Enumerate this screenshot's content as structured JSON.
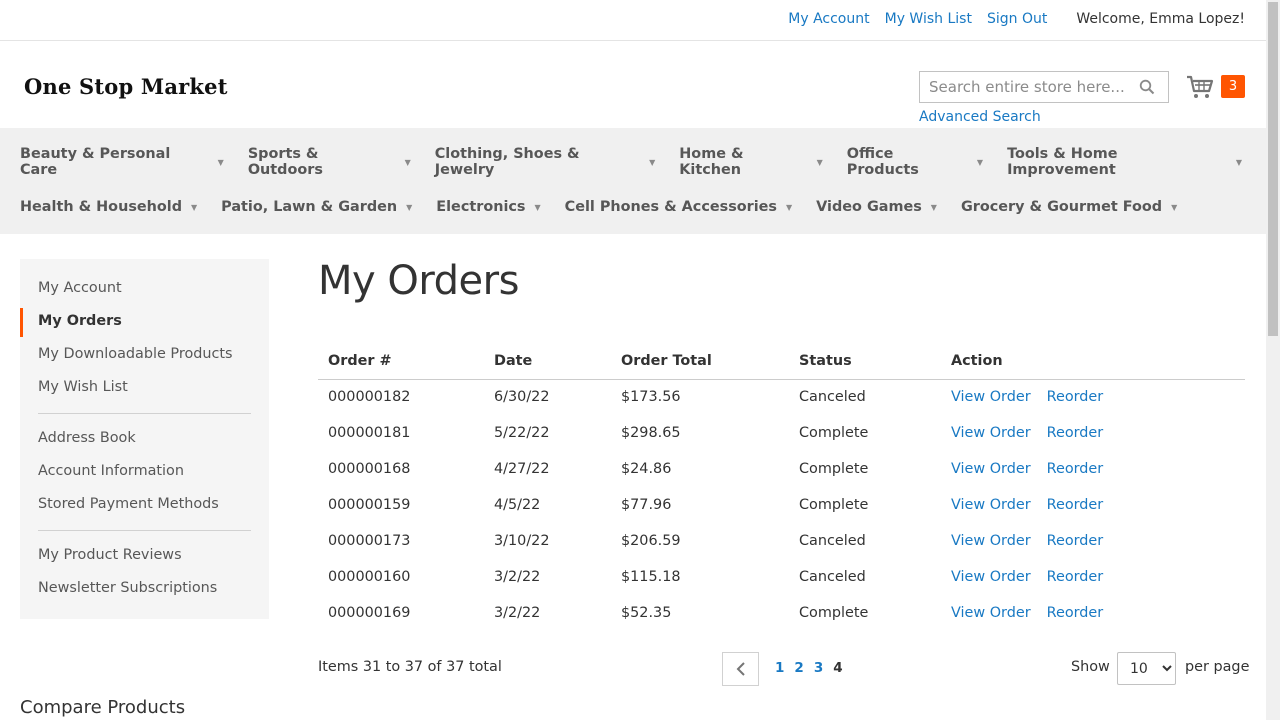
{
  "header": {
    "links": [
      "My Account",
      "My Wish List",
      "Sign Out"
    ],
    "welcome": "Welcome, Emma Lopez!"
  },
  "logo": {
    "text": "One Stop Market"
  },
  "search": {
    "placeholder": "Search entire store here...",
    "icon": "search-icon",
    "advanced_label": "Advanced Search"
  },
  "cart": {
    "icon": "cart-icon",
    "count": "3"
  },
  "nav": {
    "row1": [
      "Beauty & Personal Care",
      "Sports & Outdoors",
      "Clothing, Shoes & Jewelry",
      "Home & Kitchen",
      "Office Products",
      "Tools & Home Improvement"
    ],
    "row2": [
      "Health & Household",
      "Patio, Lawn & Garden",
      "Electronics",
      "Cell Phones & Accessories",
      "Video Games",
      "Grocery & Gourmet Food"
    ],
    "caret_icon": "chevron-down-icon"
  },
  "sidebar": {
    "group1": [
      "My Account",
      "My Orders",
      "My Downloadable Products",
      "My Wish List"
    ],
    "group2": [
      "Address Book",
      "Account Information",
      "Stored Payment Methods"
    ],
    "group3": [
      "My Product Reviews",
      "Newsletter Subscriptions"
    ],
    "active": "My Orders"
  },
  "compare": {
    "title": "Compare Products"
  },
  "main": {
    "title": "My Orders",
    "columns": [
      "Order #",
      "Date",
      "Order Total",
      "Status",
      "Action"
    ],
    "rows": [
      {
        "id": "000000182",
        "date": "6/30/22",
        "total": "$173.56",
        "status": "Canceled"
      },
      {
        "id": "000000181",
        "date": "5/22/22",
        "total": "$298.65",
        "status": "Complete"
      },
      {
        "id": "000000168",
        "date": "4/27/22",
        "total": "$24.86",
        "status": "Complete"
      },
      {
        "id": "000000159",
        "date": "4/5/22",
        "total": "$77.96",
        "status": "Complete"
      },
      {
        "id": "000000173",
        "date": "3/10/22",
        "total": "$206.59",
        "status": "Canceled"
      },
      {
        "id": "000000160",
        "date": "3/2/22",
        "total": "$115.18",
        "status": "Canceled"
      },
      {
        "id": "000000169",
        "date": "3/2/22",
        "total": "$52.35",
        "status": "Complete"
      }
    ],
    "actions": {
      "view": "View Order",
      "reorder": "Reorder"
    }
  },
  "toolbar": {
    "amount": "Items 31 to 37 of 37 total",
    "prev_icon": "chevron-left-icon",
    "pages": [
      "1",
      "2",
      "3",
      "4"
    ],
    "current_page": "4",
    "show_label": "Show",
    "limit_options": [
      "10"
    ],
    "limit_selected": "10",
    "per_page_label": "per page"
  },
  "colors": {
    "link": "#1979c3",
    "accent": "#ff5501",
    "nav_bg": "#f0f0f0",
    "sidebar_bg": "#f5f5f5"
  }
}
